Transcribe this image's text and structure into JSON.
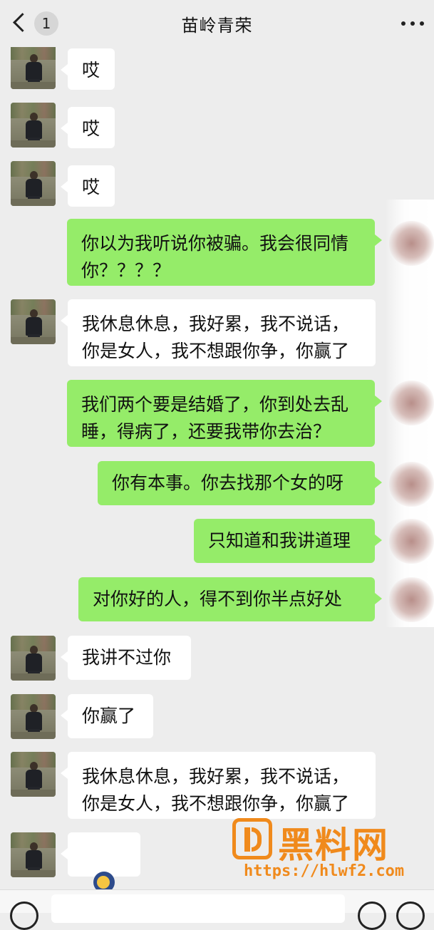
{
  "header": {
    "title": "苗岭青荣",
    "back_count": "1"
  },
  "messages": [
    {
      "side": "in",
      "text": "哎"
    },
    {
      "side": "in",
      "text": "哎"
    },
    {
      "side": "in",
      "text": "哎"
    },
    {
      "side": "out",
      "text": "你以为我听说你被骗。我会很同情\n你？？？？"
    },
    {
      "side": "in",
      "text": "我休息休息，我好累，我不说话，\n你是女人，我不想跟你争，你赢了"
    },
    {
      "side": "out",
      "text": "我们两个要是结婚了，你到处去乱\n睡，得病了，还要我带你去治？"
    },
    {
      "side": "out",
      "text": "你有本事。你去找那个女的呀"
    },
    {
      "side": "out",
      "text": "只知道和我讲道理"
    },
    {
      "side": "out",
      "text": "对你好的人，得不到你半点好处"
    },
    {
      "side": "in",
      "text": "我讲不过你"
    },
    {
      "side": "in",
      "text": "你赢了"
    },
    {
      "side": "in",
      "text": "我休息休息，我好累，我不说话，\n你是女人，我不想跟你争，你赢了"
    },
    {
      "side": "in",
      "text": ""
    }
  ],
  "watermark": {
    "brand": "黑料网",
    "url": "https://hlwf2.com"
  },
  "colors": {
    "background": "#ededed",
    "outgoing_bubble": "#95ec69",
    "incoming_bubble": "#ffffff",
    "watermark": "#f08a1c"
  },
  "icons": {
    "back": "chevron-left-icon",
    "more": "more-dots-icon",
    "voice": "voice-icon",
    "emoji": "emoji-icon",
    "plus": "plus-icon"
  }
}
